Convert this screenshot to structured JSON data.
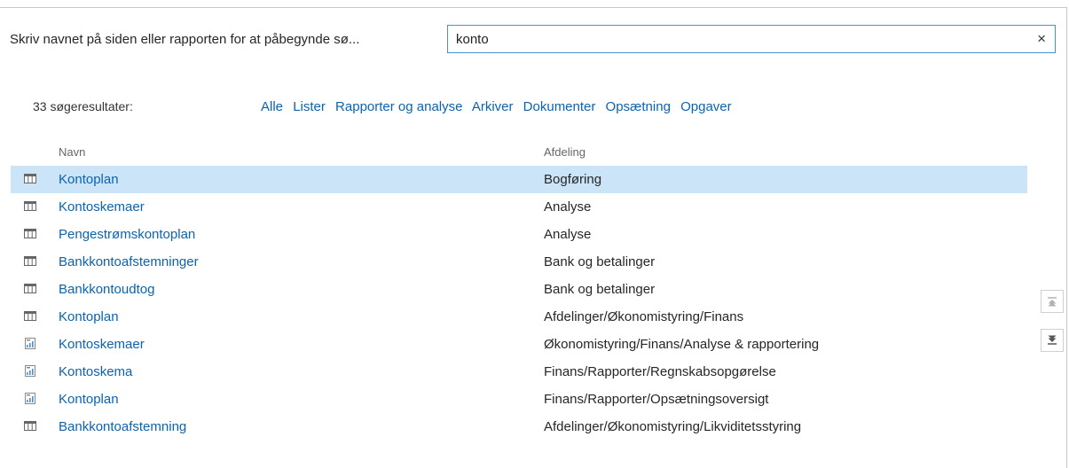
{
  "search": {
    "label": "Skriv navnet på siden eller rapporten for at påbegynde sø...",
    "value": "konto",
    "clear_label": "×"
  },
  "results": {
    "count_text": "33 søgeresultater:"
  },
  "filters": [
    "Alle",
    "Lister",
    "Rapporter og analyse",
    "Arkiver",
    "Dokumenter",
    "Opsætning",
    "Opgaver"
  ],
  "table": {
    "headers": {
      "name": "Navn",
      "department": "Afdeling"
    },
    "rows": [
      {
        "name": "Kontoplan",
        "department": "Bogføring",
        "icon": "list-icon",
        "selected": true
      },
      {
        "name": "Kontoskemaer",
        "department": "Analyse",
        "icon": "list-icon"
      },
      {
        "name": "Pengestrømskontoplan",
        "department": "Analyse",
        "icon": "list-icon"
      },
      {
        "name": "Bankkontoafstemninger",
        "department": "Bank og betalinger",
        "icon": "list-icon"
      },
      {
        "name": "Bankkontoudtog",
        "department": "Bank og betalinger",
        "icon": "list-icon"
      },
      {
        "name": "Kontoplan",
        "department": "Afdelinger/Økonomistyring/Finans",
        "icon": "list-icon"
      },
      {
        "name": "Kontoskemaer",
        "department": "Økonomistyring/Finans/Analyse & rapportering",
        "icon": "report-icon"
      },
      {
        "name": "Kontoskema",
        "department": "Finans/Rapporter/Regnskabsopgørelse",
        "icon": "report-icon"
      },
      {
        "name": "Kontoplan",
        "department": "Finans/Rapporter/Opsætningsoversigt",
        "icon": "report-icon"
      },
      {
        "name": "Bankkontoafstemning",
        "department": "Afdelinger/Økonomistyring/Likviditetsstyring",
        "icon": "list-icon"
      }
    ]
  },
  "scroll": {
    "up_icon": "scroll-to-top-icon",
    "down_icon": "scroll-to-bottom-icon"
  },
  "colors": {
    "link": "#0b63b0",
    "selected_row": "#cce4f7",
    "search_border": "#4a90d9"
  }
}
